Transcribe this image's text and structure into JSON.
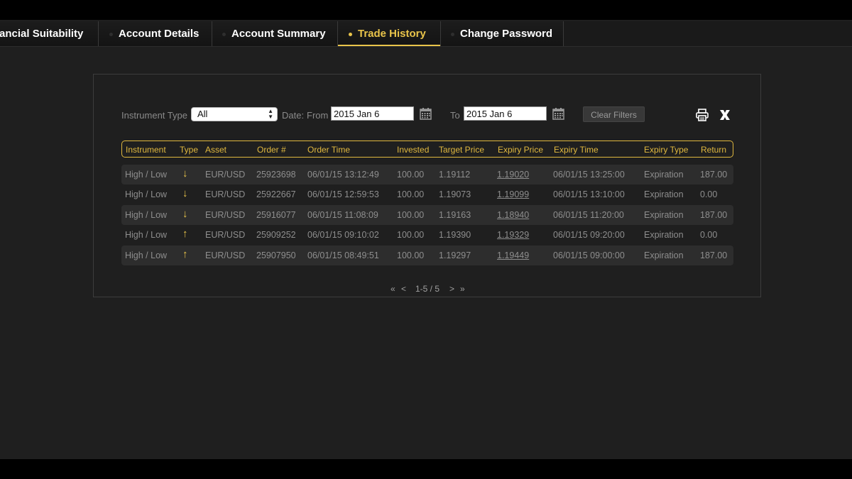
{
  "tabs": [
    {
      "label": "ancial Suitability",
      "active": false
    },
    {
      "label": "Account Details",
      "active": false
    },
    {
      "label": "Account Summary",
      "active": false
    },
    {
      "label": "Trade History",
      "active": true
    },
    {
      "label": "Change Password",
      "active": false
    }
  ],
  "filters": {
    "instrument_type_label": "Instrument Type",
    "instrument_type_value": "All",
    "date_label": "Date:",
    "from_label": "From",
    "from_value": "2015 Jan 6",
    "to_label": "To",
    "to_value": "2015 Jan 6",
    "clear_label": "Clear Filters"
  },
  "icons": {
    "calendar": "calendar-icon",
    "print": "print-icon",
    "excel": "excel-export-icon",
    "sort": "sort-arrows-icon"
  },
  "colors": {
    "accent": "#e0b83f",
    "background": "#1f1f1f",
    "row_alt": "#2d2d2d",
    "text_muted": "#8e8e8e"
  },
  "table": {
    "columns": [
      "Instrument",
      "Type",
      "Asset",
      "Order #",
      "Order Time",
      "Invested",
      "Target Price",
      "Expiry Price",
      "Expiry Time",
      "Expiry Type",
      "Return"
    ],
    "rows": [
      {
        "instrument": "High / Low",
        "type": "↓",
        "type_icon": "down-arrow-icon",
        "asset": "EUR/USD",
        "order": "25923698",
        "order_time": "06/01/15 13:12:49",
        "invested": "100.00",
        "target": "1.19112",
        "expiry_price": "1.19020",
        "expiry_time": "06/01/15 13:25:00",
        "expiry_type": "Expiration",
        "return": "187.00"
      },
      {
        "instrument": "High / Low",
        "type": "↓",
        "type_icon": "down-arrow-icon",
        "asset": "EUR/USD",
        "order": "25922667",
        "order_time": "06/01/15 12:59:53",
        "invested": "100.00",
        "target": "1.19073",
        "expiry_price": "1.19099",
        "expiry_time": "06/01/15 13:10:00",
        "expiry_type": "Expiration",
        "return": "0.00"
      },
      {
        "instrument": "High / Low",
        "type": "↓",
        "type_icon": "down-arrow-icon",
        "asset": "EUR/USD",
        "order": "25916077",
        "order_time": "06/01/15 11:08:09",
        "invested": "100.00",
        "target": "1.19163",
        "expiry_price": "1.18940",
        "expiry_time": "06/01/15 11:20:00",
        "expiry_type": "Expiration",
        "return": "187.00"
      },
      {
        "instrument": "High / Low",
        "type": "↑",
        "type_icon": "up-arrow-icon",
        "asset": "EUR/USD",
        "order": "25909252",
        "order_time": "06/01/15 09:10:02",
        "invested": "100.00",
        "target": "1.19390",
        "expiry_price": "1.19329",
        "expiry_time": "06/01/15 09:20:00",
        "expiry_type": "Expiration",
        "return": "0.00"
      },
      {
        "instrument": "High / Low",
        "type": "↑",
        "type_icon": "up-arrow-icon",
        "asset": "EUR/USD",
        "order": "25907950",
        "order_time": "06/01/15 08:49:51",
        "invested": "100.00",
        "target": "1.19297",
        "expiry_price": "1.19449",
        "expiry_time": "06/01/15 09:00:00",
        "expiry_type": "Expiration",
        "return": "187.00"
      }
    ]
  },
  "pagination": {
    "first": "«",
    "prev": "<",
    "range": "1-5 / 5",
    "next": ">",
    "last": "»"
  }
}
